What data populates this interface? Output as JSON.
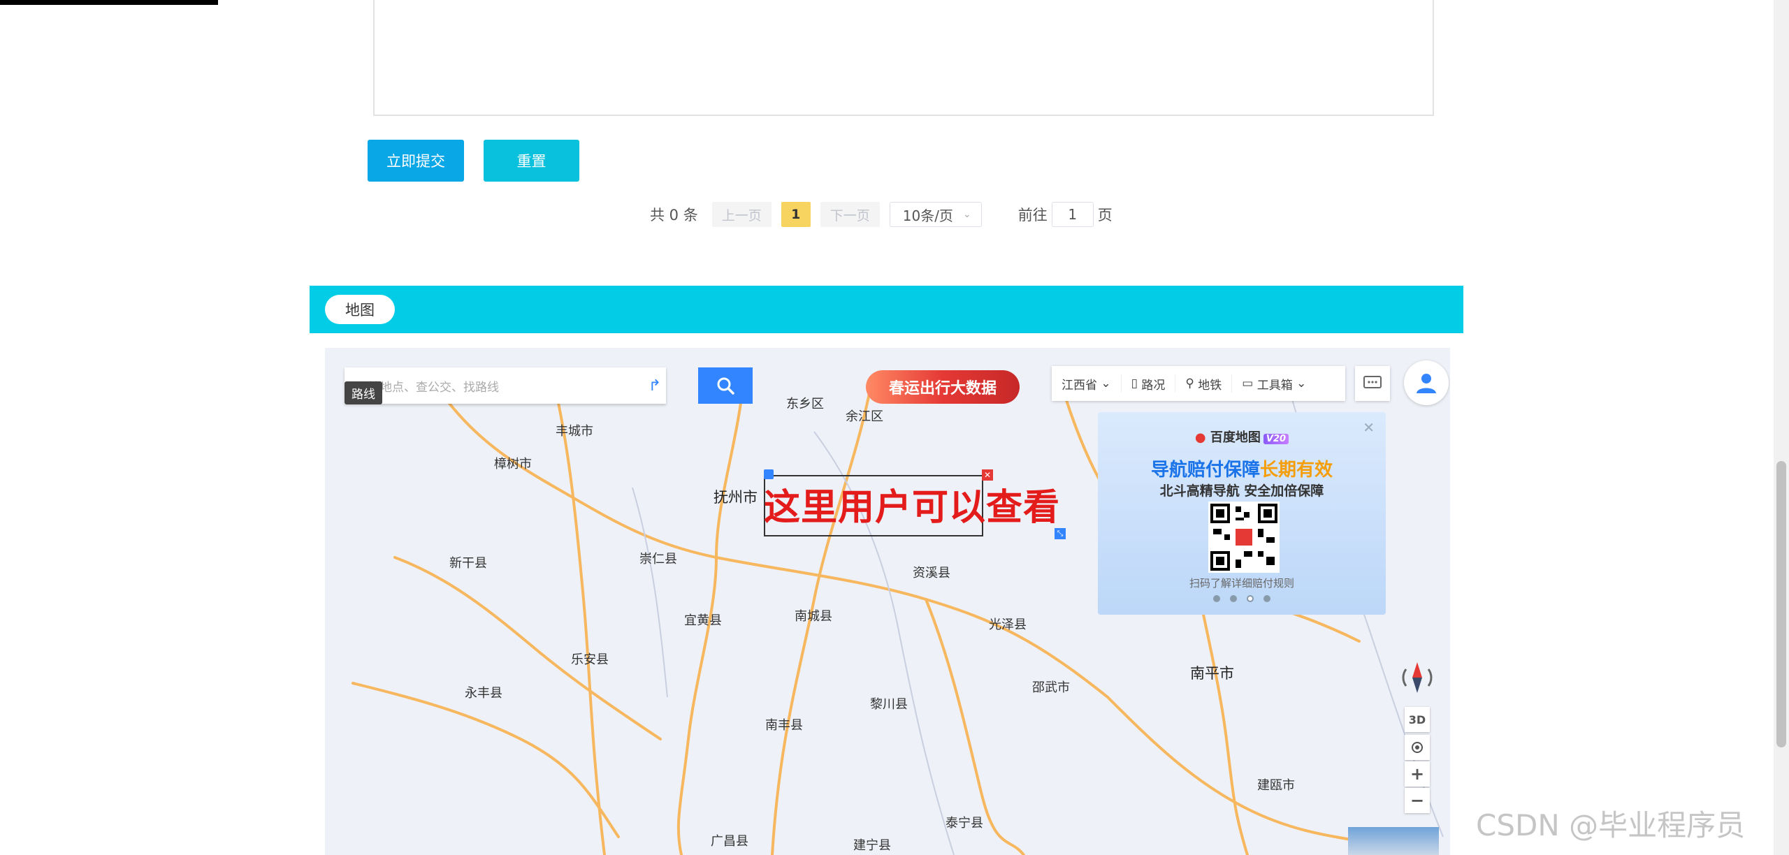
{
  "form": {
    "submit_label": "立即提交",
    "reset_label": "重置"
  },
  "pagination": {
    "total_text": "共 0 条",
    "prev_label": "上一页",
    "current_page": "1",
    "next_label": "下一页",
    "page_size": "10条/页",
    "jump_prefix": "前往",
    "jump_value": "1",
    "jump_suffix": "页"
  },
  "map_section": {
    "tab_label": "地图",
    "search_placeholder": "搜地点、查公交、找路线",
    "route_tip": "路线",
    "banner_text": "春运出行大数据",
    "toolbar": {
      "province": "江西省",
      "traffic": "路况",
      "subway": "地铁",
      "toolbox": "工具箱"
    },
    "promo": {
      "brand": "百度地图",
      "version": "V20",
      "headline_a": "导航赔付保障",
      "headline_b": "长期有效",
      "subline": "北斗高精导航 安全加倍保障",
      "note": "扫码了解详细赔付规则"
    },
    "overlay_text": "这里用户可以查看",
    "controls": {
      "three_d": "3D",
      "zoom_in": "+",
      "zoom_out": "−"
    },
    "cities": {
      "dongxiang": "东乡区",
      "yujiang": "余江区",
      "fengcheng": "丰城市",
      "zhangshu": "樟树市",
      "fuzhou": "抚州市",
      "xingan": "新干县",
      "chongren": "崇仁县",
      "zixi": "资溪县",
      "yihuang": "宜黄县",
      "nancheng": "南城县",
      "guangze": "光泽县",
      "lean": "乐安县",
      "yongfeng": "永丰县",
      "shaowu": "邵武市",
      "nanping": "南平市",
      "lichuan": "黎川县",
      "nanfeng": "南丰县",
      "jianou": "建瓯市",
      "taining": "泰宁县",
      "guangchang": "广昌县",
      "jianning": "建宁县"
    }
  },
  "watermark": "CSDN @毕业程序员",
  "colors": {
    "submit": "#0aa7e6",
    "reset": "#09c1dc",
    "map_bar": "#03cde6",
    "current_page": "#f7d45f",
    "overlay_text": "#e41b1b"
  }
}
